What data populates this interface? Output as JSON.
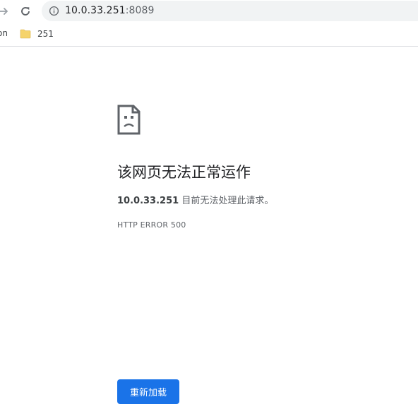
{
  "toolbar": {
    "forward_icon": "arrow-right-icon",
    "reload_icon": "reload-icon",
    "info_icon": "info-icon",
    "url_host": "10.0.33.251",
    "url_port": ":8089"
  },
  "bookmarks": {
    "partial_label": "on",
    "items": [
      {
        "label": "251",
        "icon": "folder-icon",
        "icon_color": "#f5d36b"
      }
    ]
  },
  "error": {
    "icon": "sad-page-icon",
    "title": "该网页无法正常运作",
    "host": "10.0.33.251",
    "description_rest": " 目前无法处理此请求。",
    "code": "HTTP ERROR 500",
    "reload_label": "重新加载",
    "accent_color": "#1a73e8"
  }
}
